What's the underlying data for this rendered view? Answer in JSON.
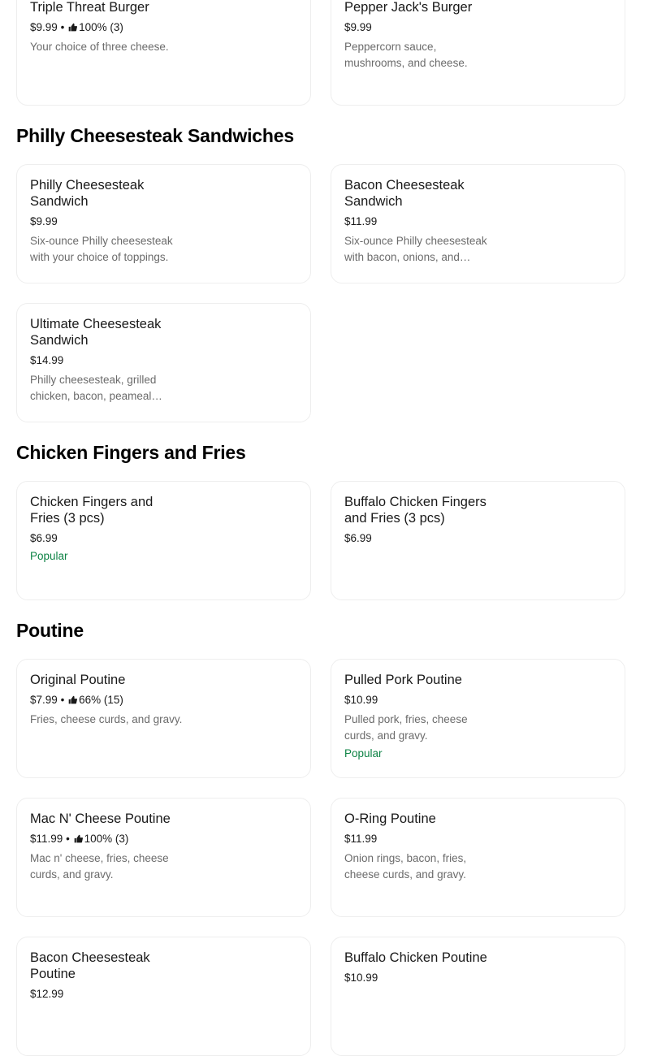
{
  "sections": {
    "philly": {
      "title": "Philly Cheesesteak Sandwiches"
    },
    "fingers": {
      "title": "Chicken Fingers and Fries"
    },
    "poutine": {
      "title": "Poutine"
    }
  },
  "items": {
    "triple_threat": {
      "name": "Triple Threat Burger",
      "price": "$9.99",
      "sep": "•",
      "rating": "100% (3)",
      "icon": "thumbs-up-icon",
      "desc": "Your choice of three cheese."
    },
    "pepper_jack": {
      "name": "Pepper Jack's Burger",
      "price": "$9.99",
      "desc": "Peppercorn sauce, mushrooms, and cheese."
    },
    "philly_sandwich": {
      "name": "Philly Cheesesteak Sandwich",
      "price": "$9.99",
      "desc": "Six-ounce Philly cheesesteak with your choice of toppings."
    },
    "bacon_cheesesteak": {
      "name": "Bacon Cheesesteak Sandwich",
      "price": "$11.99",
      "desc": "Six-ounce Philly cheesesteak with bacon, onions, and cheese."
    },
    "ultimate_cheesesteak": {
      "name": "Ultimate Cheesesteak Sandwich",
      "price": "$14.99",
      "desc": "Philly cheesesteak, grilled chicken, bacon, peameal bacon, and cheese."
    },
    "chicken_fingers": {
      "name": "Chicken Fingers and Fries (3 pcs)",
      "price": "$6.99",
      "badge": "Popular"
    },
    "buffalo_fingers": {
      "name": "Buffalo Chicken Fingers and Fries (3 pcs)",
      "price": "$6.99"
    },
    "original_poutine": {
      "name": "Original Poutine",
      "price": "$7.99",
      "sep": "•",
      "rating": "66% (15)",
      "icon": "thumbs-up-icon",
      "desc": "Fries, cheese curds, and gravy."
    },
    "pulled_pork_poutine": {
      "name": "Pulled Pork Poutine",
      "price": "$10.99",
      "desc": "Pulled pork, fries, cheese curds, and gravy.",
      "badge": "Popular"
    },
    "mac_poutine": {
      "name": "Mac N' Cheese Poutine",
      "price": "$11.99",
      "sep": "•",
      "rating": "100% (3)",
      "icon": "thumbs-up-icon",
      "desc": "Mac n' cheese, fries, cheese curds, and gravy."
    },
    "oring_poutine": {
      "name": "O-Ring Poutine",
      "price": "$11.99",
      "desc": "Onion rings, bacon, fries, cheese curds, and gravy."
    },
    "bacon_cheesesteak_poutine": {
      "name": "Bacon Cheesesteak Poutine",
      "price": "$12.99"
    },
    "buffalo_poutine": {
      "name": "Buffalo Chicken Poutine",
      "price": "$10.99"
    }
  },
  "colors": {
    "popular": "#0e8345",
    "description": "#6b6b6b",
    "card_border": "#eeeeee"
  }
}
